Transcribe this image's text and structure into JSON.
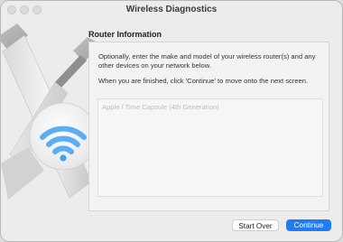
{
  "window": {
    "title": "Wireless Diagnostics"
  },
  "section": {
    "heading": "Router Information"
  },
  "panel": {
    "intro_text": "Optionally, enter the make and model of your wireless router(s) and any other devices on your network below.",
    "continue_text": "When you are finished, click 'Continue' to move onto the next screen.",
    "router_input": {
      "value": "",
      "placeholder": "Apple / Time Capsule (4th Generation)"
    }
  },
  "buttons": {
    "start_over": "Start Over",
    "continue": "Continue"
  },
  "colors": {
    "accent": "#1f7cf2",
    "wifi_icon": "#3fa0f4"
  }
}
